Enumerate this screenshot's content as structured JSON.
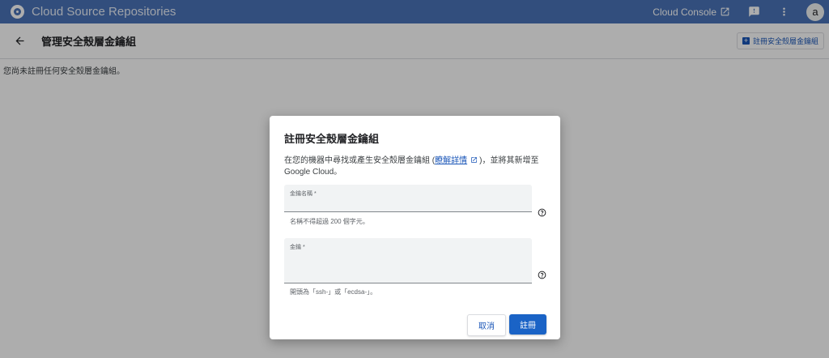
{
  "topbar": {
    "app_title": "Cloud Source Repositories",
    "console_link": "Cloud Console",
    "avatar_letter": "a",
    "icons": [
      "logo-icon",
      "open-in-new-icon",
      "feedback-icon",
      "more-vert-icon"
    ]
  },
  "subheader": {
    "page_title": "管理安全殼層金鑰組",
    "register_button": "註冊安全殼層金鑰組",
    "icons": [
      "arrow-back-icon",
      "add-box-icon"
    ]
  },
  "main": {
    "empty_message": "您尚未註冊任何安全殼層金鑰組。"
  },
  "dialog": {
    "title": "註冊安全殼層金鑰組",
    "desc_before": "在您的機器中尋找或產生安全殼層金鑰組 (",
    "learn_more": "瞭解詳情",
    "desc_after": ")，並將其新增至 Google Cloud。",
    "key_name_label": "金鑰名稱 *",
    "key_name_value": "",
    "key_name_hint": "名稱不得超過 200 個字元。",
    "key_label": "金鑰 *",
    "key_value": "",
    "key_hint": "開頭為「ssh-」或「ecdsa-」。",
    "cancel_label": "取消",
    "register_label": "註冊",
    "icons": [
      "help-icon",
      "open-in-new-icon"
    ]
  },
  "colors": {
    "topbar": "#4a74b8",
    "primary": "#1a63c6",
    "link": "#1a56b8"
  }
}
